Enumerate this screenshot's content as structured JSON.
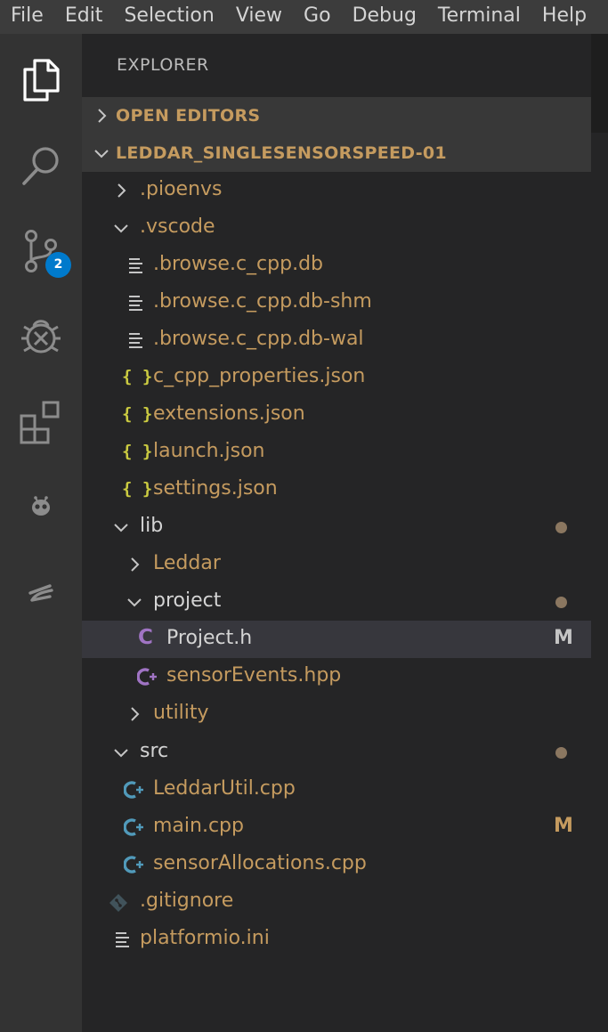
{
  "menu": [
    "File",
    "Edit",
    "Selection",
    "View",
    "Go",
    "Debug",
    "Terminal",
    "Help"
  ],
  "activity": {
    "scm_badge": "2",
    "items": [
      "explorer-icon",
      "search-icon",
      "source-control-icon",
      "debug-icon",
      "extensions-icon",
      "platformio-alien-icon",
      "settings-sync-icon"
    ]
  },
  "explorer": {
    "title": "EXPLORER",
    "open_editors": "OPEN EDITORS",
    "project": "LEDDAR_SINGLESENSORSPEED-01"
  },
  "tree": [
    {
      "name": ".pioenvs",
      "icon": "chevron-right"
    },
    {
      "name": ".vscode",
      "icon": "chevron-down"
    },
    {
      "name": ".browse.c_cpp.db",
      "icon": "file-lines"
    },
    {
      "name": ".browse.c_cpp.db-shm",
      "icon": "file-lines"
    },
    {
      "name": ".browse.c_cpp.db-wal",
      "icon": "file-lines"
    },
    {
      "name": "c_cpp_properties.json",
      "icon": "json-braces"
    },
    {
      "name": "extensions.json",
      "icon": "json-braces"
    },
    {
      "name": "launch.json",
      "icon": "json-braces"
    },
    {
      "name": "settings.json",
      "icon": "json-braces"
    },
    {
      "name": "lib",
      "icon": "chevron-down"
    },
    {
      "name": "Leddar",
      "icon": "chevron-right"
    },
    {
      "name": "project",
      "icon": "chevron-down"
    },
    {
      "name": "Project.h",
      "icon": "c-header",
      "badge": "M"
    },
    {
      "name": "sensorEvents.hpp",
      "icon": "cpp-header"
    },
    {
      "name": "utility",
      "icon": "chevron-right"
    },
    {
      "name": "src",
      "icon": "chevron-down"
    },
    {
      "name": "LeddarUtil.cpp",
      "icon": "cpp-source"
    },
    {
      "name": "main.cpp",
      "icon": "cpp-source",
      "badge": "M"
    },
    {
      "name": "sensorAllocations.cpp",
      "icon": "cpp-source"
    },
    {
      "name": ".gitignore",
      "icon": "git-diamond"
    },
    {
      "name": "platformio.ini",
      "icon": "file-lines"
    }
  ],
  "json_icon_glyph": "{ }",
  "c_icon_glyph": "C",
  "colors": {
    "menubar": "#3c3c3c",
    "activitybar": "#333333",
    "sidebar": "#252526",
    "section_header": "#383838",
    "selected_row": "#37373d",
    "folder_text": "#c59b5f",
    "badge_blue": "#007acc",
    "modified_dot": "#8b7760",
    "json_yellow": "#cbcb41",
    "c_purple": "#a074c4",
    "cpp_blue": "#519aba"
  }
}
